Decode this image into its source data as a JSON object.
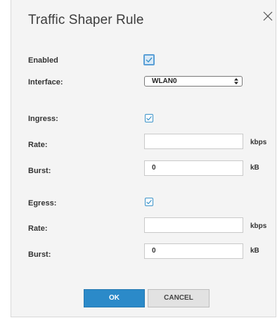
{
  "dialog": {
    "title": "Traffic Shaper Rule",
    "close_icon": "close-icon"
  },
  "form": {
    "enabled_label": "Enabled",
    "enabled_checked": true,
    "interface_label": "Interface:",
    "interface_value": "WLAN0",
    "ingress": {
      "label": "Ingress:",
      "checked": true,
      "rate_label": "Rate:",
      "rate_value": "",
      "rate_unit": "kbps",
      "burst_label": "Burst:",
      "burst_value": "0",
      "burst_unit": "kB"
    },
    "egress": {
      "label": "Egress:",
      "checked": true,
      "rate_label": "Rate:",
      "rate_value": "",
      "rate_unit": "kbps",
      "burst_label": "Burst:",
      "burst_value": "0",
      "burst_unit": "kB"
    }
  },
  "buttons": {
    "ok_label": "OK",
    "cancel_label": "CANCEL"
  },
  "colors": {
    "accent": "#2b8ac9",
    "dialog_bg": "#f4f4f4",
    "checkbox": "#3b93c9"
  }
}
